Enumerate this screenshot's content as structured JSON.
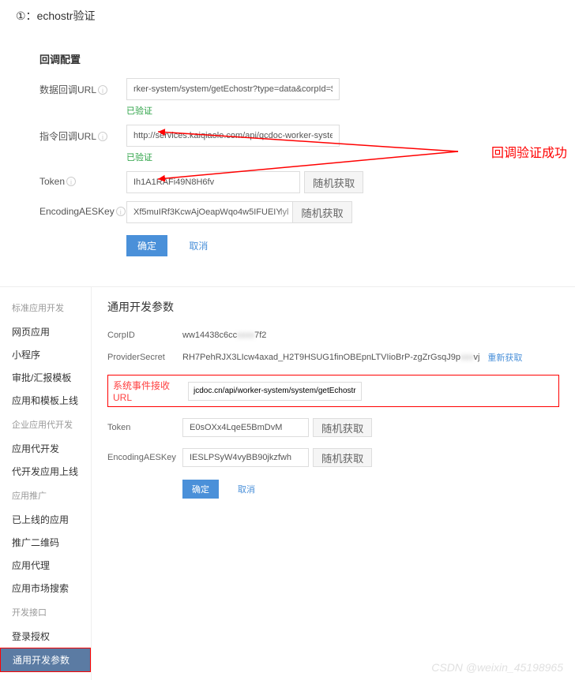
{
  "header": {
    "num": "①：",
    "title": "echostr验证"
  },
  "callback": {
    "section_title": "回调配置",
    "data_url_label": "数据回调URL",
    "data_url_value": "rker-system/system/getEchostr?type=data&corpId=$CORPID$",
    "verified_1": "已验证",
    "cmd_url_label": "指令回调URL",
    "cmd_url_value": "http://services.kaiqiaole.com/api/qcdoc-worker-system/system/",
    "verified_2": "已验证",
    "token_label": "Token",
    "token_value": "Ih1A1RAFi49N8H6fv",
    "aes_label": "EncodingAESKey",
    "aes_value": "Xf5muIRf3KcwAjOeapWqo4w5IFUEIY",
    "aes_suffix": "lyl",
    "random_btn": "随机获取",
    "submit": "确定",
    "cancel": "取消"
  },
  "annotation": "回调验证成功",
  "sidebar": {
    "groups": [
      {
        "title": "标准应用开发",
        "items": [
          "网页应用",
          "小程序",
          "审批/汇报模板",
          "应用和模板上线"
        ]
      },
      {
        "title": "企业应用代开发",
        "items": [
          "应用代开发",
          "代开发应用上线"
        ]
      },
      {
        "title": "应用推广",
        "items": [
          "已上线的应用",
          "推广二维码",
          "应用代理",
          "应用市场搜索"
        ]
      },
      {
        "title": "开发接口",
        "items": [
          "登录授权",
          "通用开发参数"
        ]
      }
    ]
  },
  "params": {
    "title": "通用开发参数",
    "corpid_label": "CorpID",
    "corpid_value": "ww14438c6cc",
    "corpid_suffix": "7f2",
    "secret_label": "ProviderSecret",
    "secret_value": "RH7PehRJX3LIcw4axad_H2T9HSUG1finOBEpnLTVIioBrP-zgZrGsqJ9p",
    "secret_suffix": "vj",
    "refresh": "重新获取",
    "event_url_label": "系统事件接收URL",
    "event_url_value": "jcdoc.cn/api/worker-system/system/getEchostr",
    "token_label": "Token",
    "token_value": "E0sOXx4LqeE5BmDvM",
    "aes_label": "EncodingAESKey",
    "aes_value": "IESLPSyW4vyBB90jkzfwh",
    "random": "随机获取",
    "submit": "确定",
    "cancel": "取消"
  },
  "watermark": "CSDN @weixin_45198965"
}
